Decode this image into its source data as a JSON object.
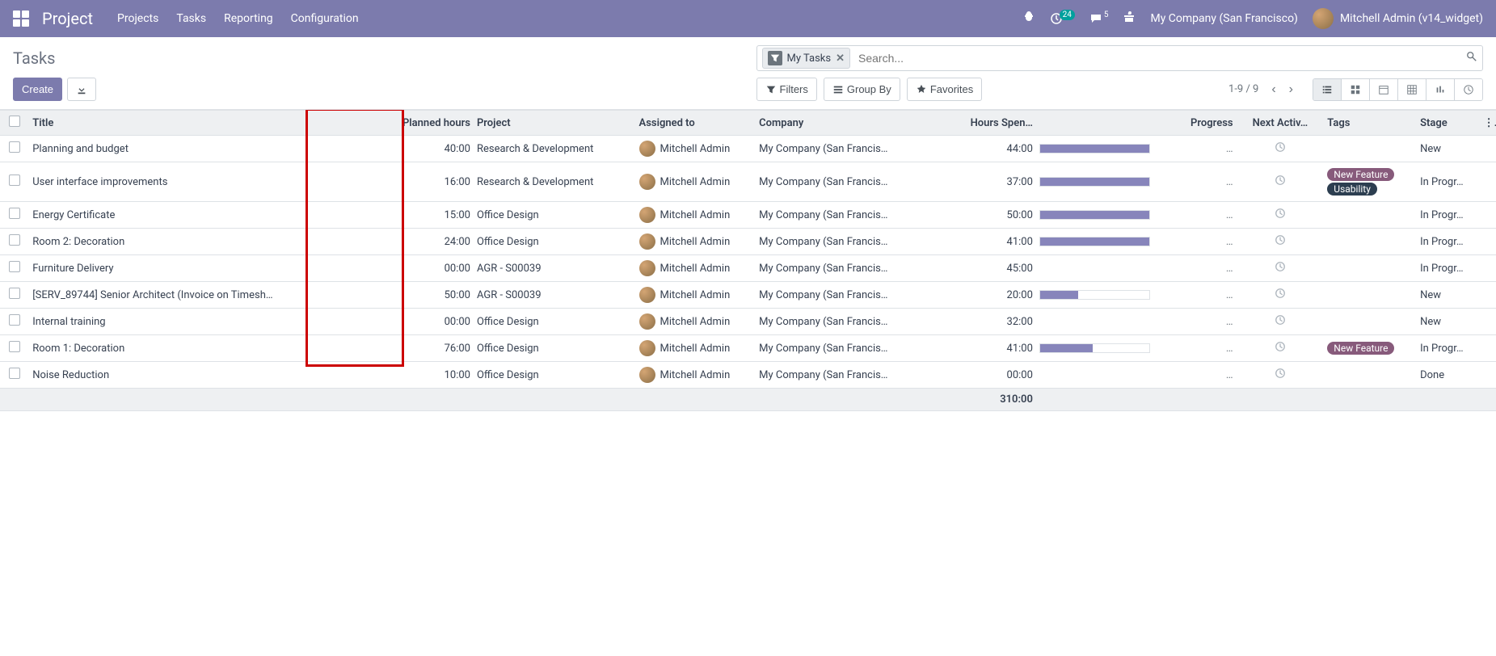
{
  "navbar": {
    "brand": "Project",
    "links": [
      "Projects",
      "Tasks",
      "Reporting",
      "Configuration"
    ],
    "notif_badge": "24",
    "msg_count": "5",
    "company": "My Company (San Francisco)",
    "user": "Mitchell Admin (v14_widget)"
  },
  "breadcrumb": "Tasks",
  "search": {
    "filter_tag": "My Tasks",
    "placeholder": "Search..."
  },
  "buttons": {
    "create": "Create",
    "filters": "Filters",
    "groupby": "Group By",
    "favorites": "Favorites"
  },
  "pager": "1-9 / 9",
  "columns": {
    "title": "Title",
    "planned": "Planned hours",
    "project": "Project",
    "assigned": "Assigned to",
    "company": "Company",
    "hours": "Hours Spen…",
    "progress": "Progress",
    "activity": "Next Activ…",
    "tags": "Tags",
    "stage": "Stage"
  },
  "rows": [
    {
      "title": "Planning and budget",
      "planned": "40:00",
      "project": "Research & Development",
      "assignee": "Mitchell Admin",
      "company": "My Company (San Francis…",
      "hours": "44:00",
      "progress": 100,
      "tags": [],
      "stage": "New"
    },
    {
      "title": "User interface improvements",
      "planned": "16:00",
      "project": "Research & Development",
      "assignee": "Mitchell Admin",
      "company": "My Company (San Francis…",
      "hours": "37:00",
      "progress": 100,
      "tags": [
        "New Feature",
        "Usability"
      ],
      "stage": "In Progr…"
    },
    {
      "title": "Energy Certificate",
      "planned": "15:00",
      "project": "Office Design",
      "assignee": "Mitchell Admin",
      "company": "My Company (San Francis…",
      "hours": "50:00",
      "progress": 100,
      "tags": [],
      "stage": "In Progr…"
    },
    {
      "title": "Room 2: Decoration",
      "planned": "24:00",
      "project": "Office Design",
      "assignee": "Mitchell Admin",
      "company": "My Company (San Francis…",
      "hours": "41:00",
      "progress": 100,
      "tags": [],
      "stage": "In Progr…"
    },
    {
      "title": "Furniture Delivery",
      "planned": "00:00",
      "project": "AGR - S00039",
      "assignee": "Mitchell Admin",
      "company": "My Company (San Francis…",
      "hours": "45:00",
      "progress": 0,
      "tags": [],
      "stage": "In Progr…"
    },
    {
      "title": "[SERV_89744] Senior Architect (Invoice on Timesh…",
      "planned": "50:00",
      "project": "AGR - S00039",
      "assignee": "Mitchell Admin",
      "company": "My Company (San Francis…",
      "hours": "20:00",
      "progress": 35,
      "tags": [],
      "stage": "New"
    },
    {
      "title": "Internal training",
      "planned": "00:00",
      "project": "Office Design",
      "assignee": "Mitchell Admin",
      "company": "My Company (San Francis…",
      "hours": "32:00",
      "progress": 0,
      "tags": [],
      "stage": "New"
    },
    {
      "title": "Room 1: Decoration",
      "planned": "76:00",
      "project": "Office Design",
      "assignee": "Mitchell Admin",
      "company": "My Company (San Francis…",
      "hours": "41:00",
      "progress": 48,
      "tags": [
        "New Feature"
      ],
      "stage": "In Progr…"
    },
    {
      "title": "Noise Reduction",
      "planned": "10:00",
      "project": "Office Design",
      "assignee": "Mitchell Admin",
      "company": "My Company (San Francis…",
      "hours": "00:00",
      "progress": 0,
      "tags": [],
      "stage": "Done"
    }
  ],
  "footer": {
    "total_hours": "310:00"
  },
  "tag_colors": {
    "New Feature": "#875A7B",
    "Usability": "#2C3E50"
  }
}
